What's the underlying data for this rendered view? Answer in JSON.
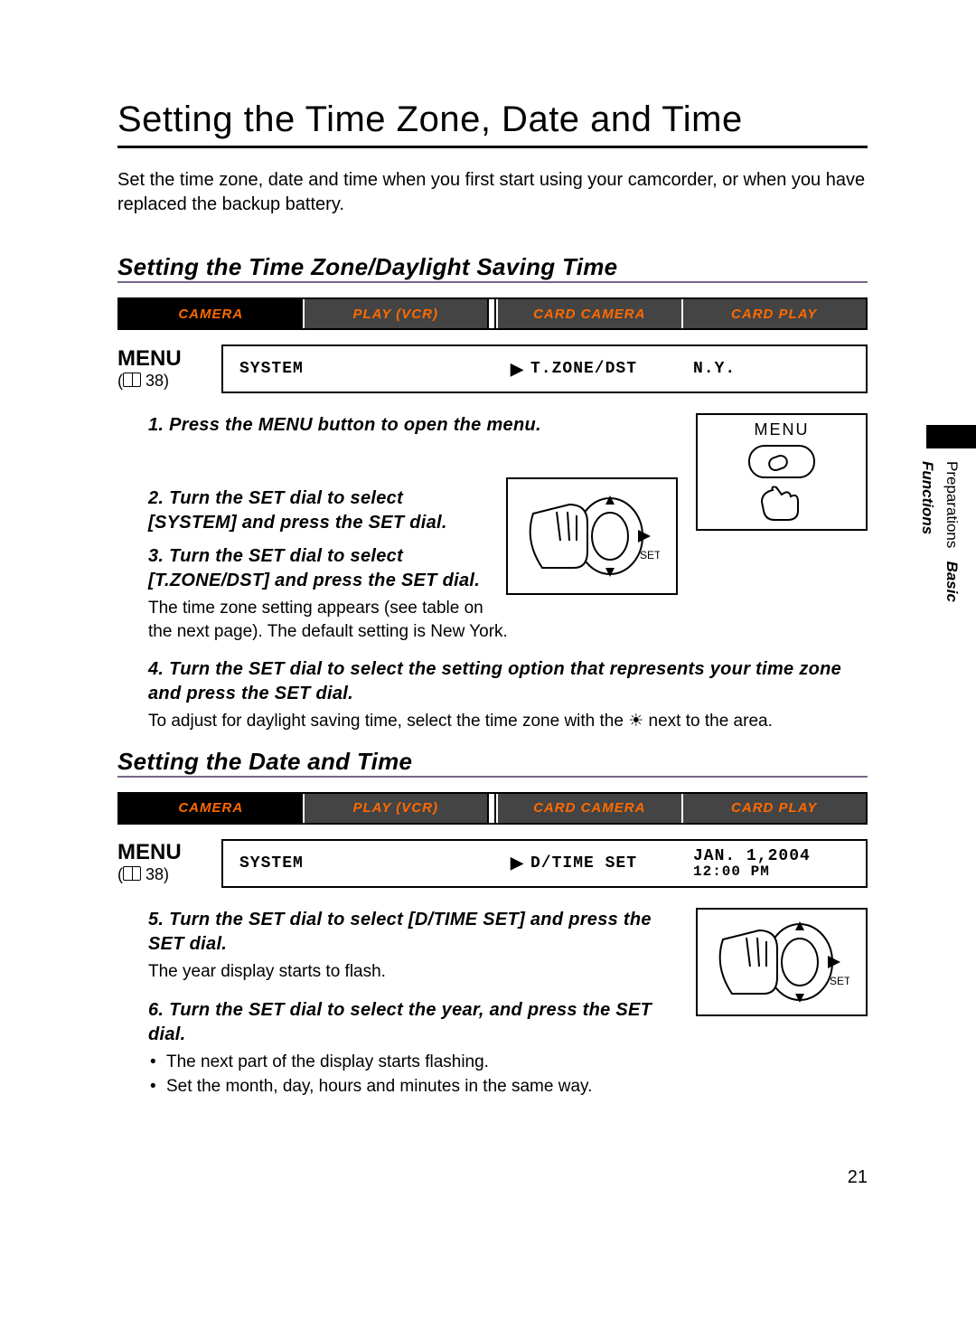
{
  "title": "Setting the Time Zone, Date and Time",
  "intro": "Set the time zone, date and time when you first start using your camcorder, or when you have replaced the backup battery.",
  "page_number": "21",
  "margin": {
    "basic": "Basic",
    "functions": "Functions",
    "prep": "Preparations"
  },
  "sections": {
    "tz": {
      "heading": "Setting the Time Zone/Daylight Saving Time",
      "modes": [
        "CAMERA",
        "PLAY (VCR)",
        "CARD CAMERA",
        "CARD PLAY"
      ],
      "menu_label": "MENU",
      "menu_ref": "38",
      "menu_path": {
        "sys": "SYSTEM",
        "setting": "T.ZONE/DST",
        "value": "N.Y."
      },
      "step1": "1. Press the MENU button to open the menu.",
      "step2": "2. Turn the SET dial to select [SYSTEM] and press the SET dial.",
      "step3": "3. Turn the SET dial to select [T.ZONE/DST] and press the SET dial.",
      "step3_body": "The time zone setting appears (see table on the next page). The default setting is New York.",
      "step4": "4. Turn the SET dial to select the setting option that represents your time zone and press the SET dial.",
      "step4_body_a": "To adjust for daylight saving time, select the time zone with the ",
      "step4_body_b": " next to the area.",
      "illo_menu_label": "MENU"
    },
    "dt": {
      "heading": "Setting the Date and Time",
      "modes": [
        "CAMERA",
        "PLAY (VCR)",
        "CARD CAMERA",
        "CARD PLAY"
      ],
      "menu_label": "MENU",
      "menu_ref": "38",
      "menu_path": {
        "sys": "SYSTEM",
        "setting": "D/TIME SET",
        "value_l1": "JAN. 1,2004",
        "value_l2": "12:00 PM"
      },
      "step5": "5. Turn the SET dial to select [D/TIME SET] and press the SET dial.",
      "step5_body": "The year display starts to flash.",
      "step6": "6. Turn the SET dial to select the year, and press the SET dial.",
      "step6_b1": "The next part of the display starts flashing.",
      "step6_b2": "Set the month, day, hours and minutes in the same way."
    }
  }
}
